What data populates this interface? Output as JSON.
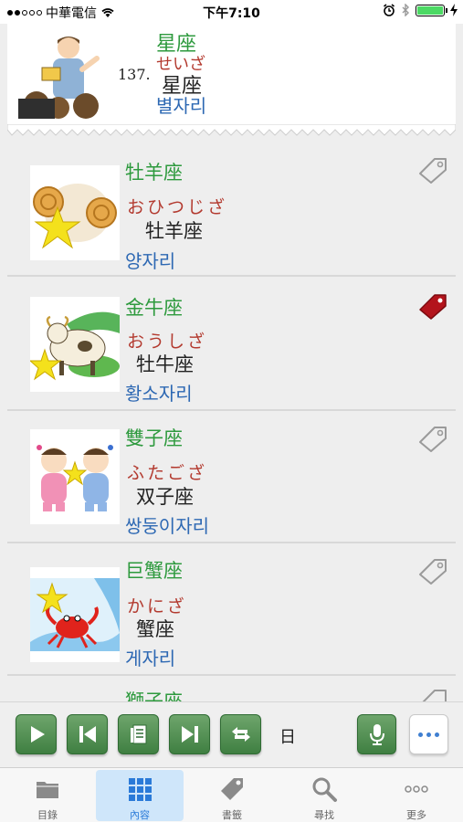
{
  "status_bar": {
    "carrier": "中華電信",
    "time": "下午7:10"
  },
  "header": {
    "number": "137.",
    "word": "星座",
    "kana": "せいざ",
    "simplified": "星座",
    "korean": "별자리",
    "illustration_icon": "teacher-reading-illustration"
  },
  "entries": [
    {
      "word": "牡羊座",
      "kana": "おひつじざ",
      "simplified": "牡羊座",
      "korean": "양자리",
      "bookmarked": false,
      "image_icon": "ram-star-illustration"
    },
    {
      "word": "金牛座",
      "kana": "おうしざ",
      "simplified": "牡牛座",
      "korean": "황소자리",
      "bookmarked": true,
      "image_icon": "bull-star-illustration"
    },
    {
      "word": "雙子座",
      "kana": "ふたござ",
      "simplified": "双子座",
      "korean": "쌍둥이자리",
      "bookmarked": false,
      "image_icon": "twins-star-illustration"
    },
    {
      "word": "巨蟹座",
      "kana": "かにざ",
      "simplified": "蟹座",
      "korean": "게자리",
      "bookmarked": false,
      "image_icon": "crab-star-illustration"
    },
    {
      "word": "獅子座",
      "kana": "",
      "simplified": "",
      "korean": "",
      "bookmarked": false,
      "image_icon": "lion-illustration"
    }
  ],
  "toolbar": {
    "language_label": "日",
    "buttons": [
      "play-icon",
      "previous-icon",
      "list-icon",
      "next-icon",
      "repeat-icon",
      "microphone-icon",
      "more-icon"
    ]
  },
  "tabs": [
    {
      "label": "目錄",
      "icon": "folder-icon",
      "active": false
    },
    {
      "label": "內容",
      "icon": "grid-icon",
      "active": true
    },
    {
      "label": "書籤",
      "icon": "tag-icon",
      "active": false
    },
    {
      "label": "尋找",
      "icon": "search-icon",
      "active": false
    },
    {
      "label": "更多",
      "icon": "more-dots-icon",
      "active": false
    }
  ],
  "colors": {
    "word": "#2e9a3e",
    "kana": "#b33a2f",
    "korean": "#2d68b3",
    "bookmark_active": "#b3141c",
    "tab_active": "#2a7ad8"
  }
}
